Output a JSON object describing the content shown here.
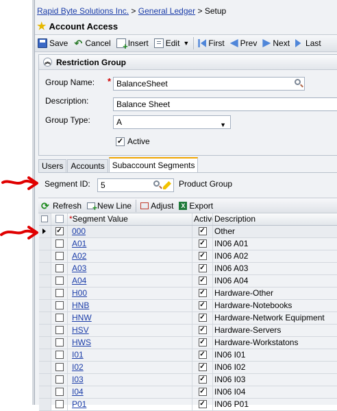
{
  "breadcrumb": {
    "company": "Rapid Byte Solutions Inc.",
    "sep1": ">",
    "module": "General Ledger",
    "sep2": "> Setup"
  },
  "page_title": "Account Access",
  "toolbar": {
    "save": "Save",
    "cancel": "Cancel",
    "insert": "Insert",
    "edit": "Edit",
    "first": "First",
    "prev": "Prev",
    "next": "Next",
    "last": "Last"
  },
  "restriction_group": {
    "header": "Restriction Group",
    "group_name_label": "Group Name:",
    "group_name_value": "BalanceSheet",
    "description_label": "Description:",
    "description_value": "Balance Sheet",
    "group_type_label": "Group Type:",
    "group_type_value": "A",
    "active_label": "Active",
    "active_checked": true
  },
  "tabs": [
    {
      "label": "Users",
      "active": false
    },
    {
      "label": "Accounts",
      "active": false
    },
    {
      "label": "Subaccount Segments",
      "active": true
    }
  ],
  "segment": {
    "label": "Segment ID:",
    "value": "5",
    "name": "Product Group"
  },
  "grid_toolbar": {
    "refresh": "Refresh",
    "new_line": "New Line",
    "adjust": "Adjust",
    "export": "Export"
  },
  "grid": {
    "columns": {
      "segment_value_req": "*",
      "segment_value": "Segment Value",
      "active": "Active",
      "description": "Description"
    },
    "rows": [
      {
        "value": "000",
        "selected": true,
        "active": true,
        "description": "Other",
        "current": true
      },
      {
        "value": "A01",
        "selected": false,
        "active": true,
        "description": "IN06 A01",
        "current": false
      },
      {
        "value": "A02",
        "selected": false,
        "active": true,
        "description": "IN06 A02",
        "current": false
      },
      {
        "value": "A03",
        "selected": false,
        "active": true,
        "description": "IN06 A03",
        "current": false
      },
      {
        "value": "A04",
        "selected": false,
        "active": true,
        "description": "IN06 A04",
        "current": false
      },
      {
        "value": "H00",
        "selected": false,
        "active": true,
        "description": "Hardware-Other",
        "current": false
      },
      {
        "value": "HNB",
        "selected": false,
        "active": true,
        "description": "Hardware-Notebooks",
        "current": false
      },
      {
        "value": "HNW",
        "selected": false,
        "active": true,
        "description": "Hardware-Network Equipment",
        "current": false
      },
      {
        "value": "HSV",
        "selected": false,
        "active": true,
        "description": "Hardware-Servers",
        "current": false
      },
      {
        "value": "HWS",
        "selected": false,
        "active": true,
        "description": "Hardware-Workstatons",
        "current": false
      },
      {
        "value": "I01",
        "selected": false,
        "active": true,
        "description": "IN06 I01",
        "current": false
      },
      {
        "value": "I02",
        "selected": false,
        "active": true,
        "description": "IN06 I02",
        "current": false
      },
      {
        "value": "I03",
        "selected": false,
        "active": true,
        "description": "IN06 I03",
        "current": false
      },
      {
        "value": "I04",
        "selected": false,
        "active": true,
        "description": "IN06 I04",
        "current": false
      },
      {
        "value": "P01",
        "selected": false,
        "active": true,
        "description": "IN06 P01",
        "current": false
      }
    ]
  },
  "colors": {
    "link": "#1a3ca8",
    "required": "#d00000",
    "annotation_arrow": "#e00000",
    "active_tab_accent": "#f0a500"
  }
}
